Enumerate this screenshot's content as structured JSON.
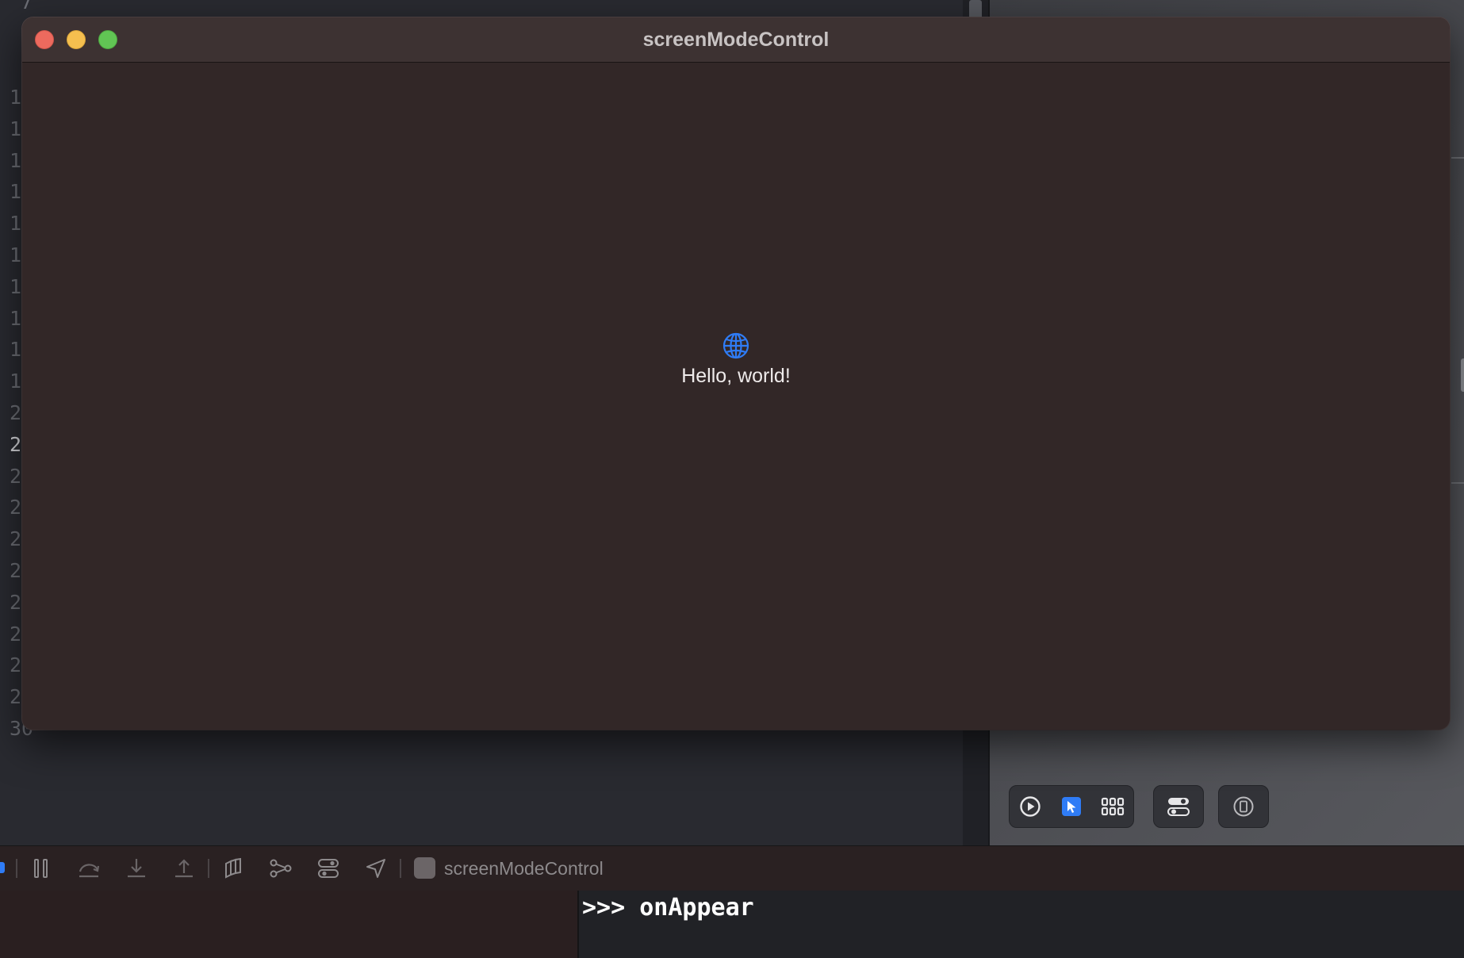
{
  "editor": {
    "top_line_fragment": "7",
    "line_numbers": [
      "1",
      "1",
      "1",
      "1",
      "1",
      "1",
      "1",
      "1",
      "1",
      "1",
      "2",
      "2",
      "2",
      "2",
      "2",
      "2",
      "2",
      "2",
      "2",
      "2",
      "30"
    ],
    "current_line_index": 11
  },
  "window": {
    "title": "screenModeControl",
    "content": {
      "icon": "globe-icon",
      "text": "Hello, world!"
    },
    "accent_color": "#2f7cf6"
  },
  "preview_toolbar": {
    "icons": [
      "play-circle-icon",
      "selectable-pointer-icon",
      "variants-grid-icon",
      "device-settings-icon",
      "device-frame-icon"
    ],
    "selected": "selectable-pointer-icon"
  },
  "debug_bar": {
    "app_name": "screenModeControl",
    "icons": [
      "pause-icon",
      "step-over-icon",
      "step-into-icon",
      "step-out-icon",
      "view-hierarchy-icon",
      "memory-graph-icon",
      "environment-overrides-icon",
      "simulate-location-icon"
    ]
  },
  "console": {
    "output": ">>> onAppear"
  }
}
